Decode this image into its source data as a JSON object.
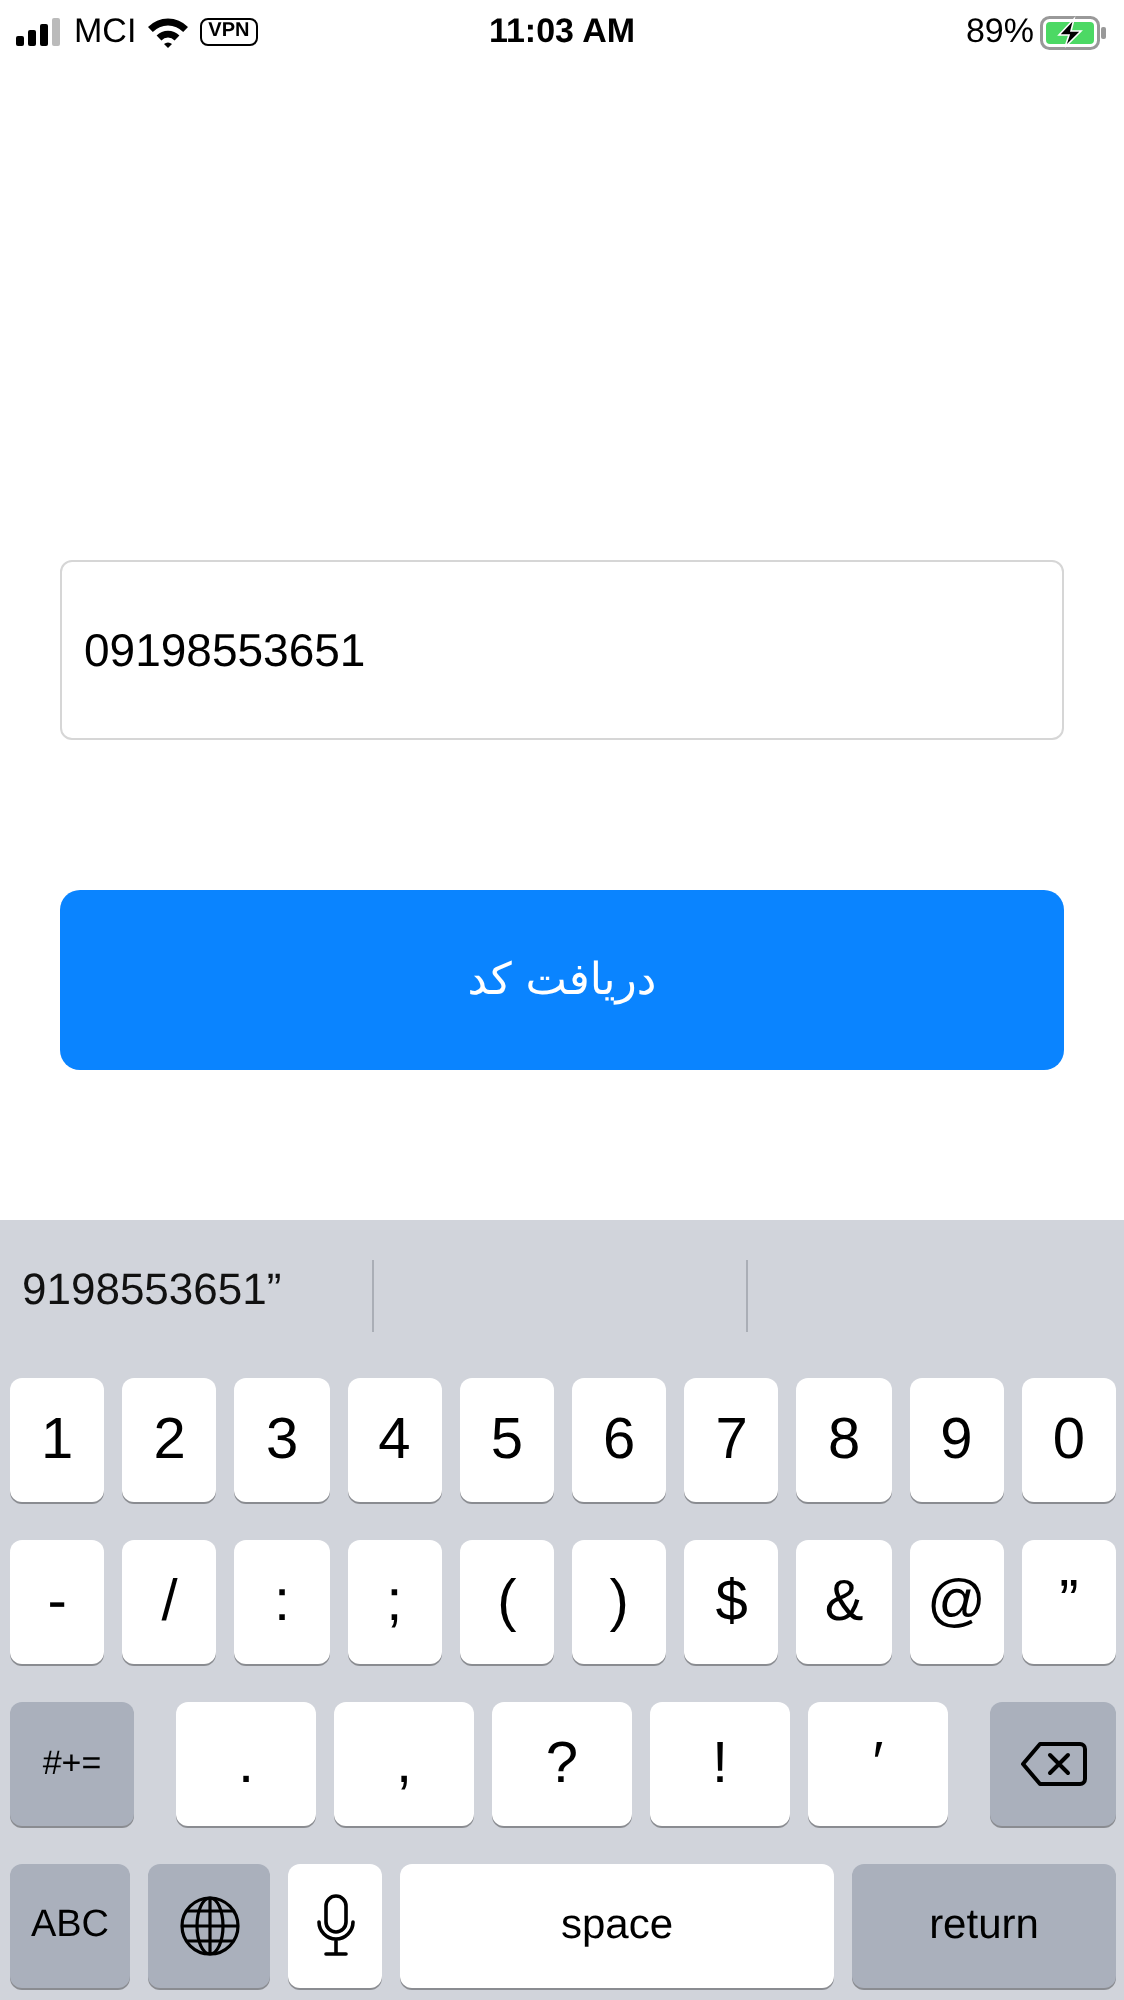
{
  "status_bar": {
    "carrier": "MCI",
    "vpn": "VPN",
    "time": "11:03 AM",
    "battery": "89%"
  },
  "phone_field": {
    "value": "09198553651"
  },
  "submit_button": {
    "label": "دریافت کد"
  },
  "keyboard": {
    "suggestions": [
      {
        "text": "9198553651”"
      }
    ],
    "number_keys": [
      {
        "label": "1"
      },
      {
        "label": "2"
      },
      {
        "label": "3"
      },
      {
        "label": "4"
      },
      {
        "label": "5"
      },
      {
        "label": "6"
      },
      {
        "label": "7"
      },
      {
        "label": "8"
      },
      {
        "label": "9"
      },
      {
        "label": "0"
      }
    ],
    "symbol_keys": [
      {
        "label": "-"
      },
      {
        "label": "/"
      },
      {
        "label": ":"
      },
      {
        "label": ";"
      },
      {
        "label": "("
      },
      {
        "label": ")"
      },
      {
        "label": "$"
      },
      {
        "label": "&"
      },
      {
        "label": "@"
      },
      {
        "label": "”"
      }
    ],
    "third_row": {
      "switch_key": "#+=",
      "punctuation_keys": [
        {
          "label": "."
        },
        {
          "label": ","
        },
        {
          "label": "?"
        },
        {
          "label": "!"
        },
        {
          "label": "′"
        }
      ]
    },
    "bottom_row": {
      "abc_key": "ABC",
      "space_key": "space",
      "return_key": "return"
    }
  }
}
